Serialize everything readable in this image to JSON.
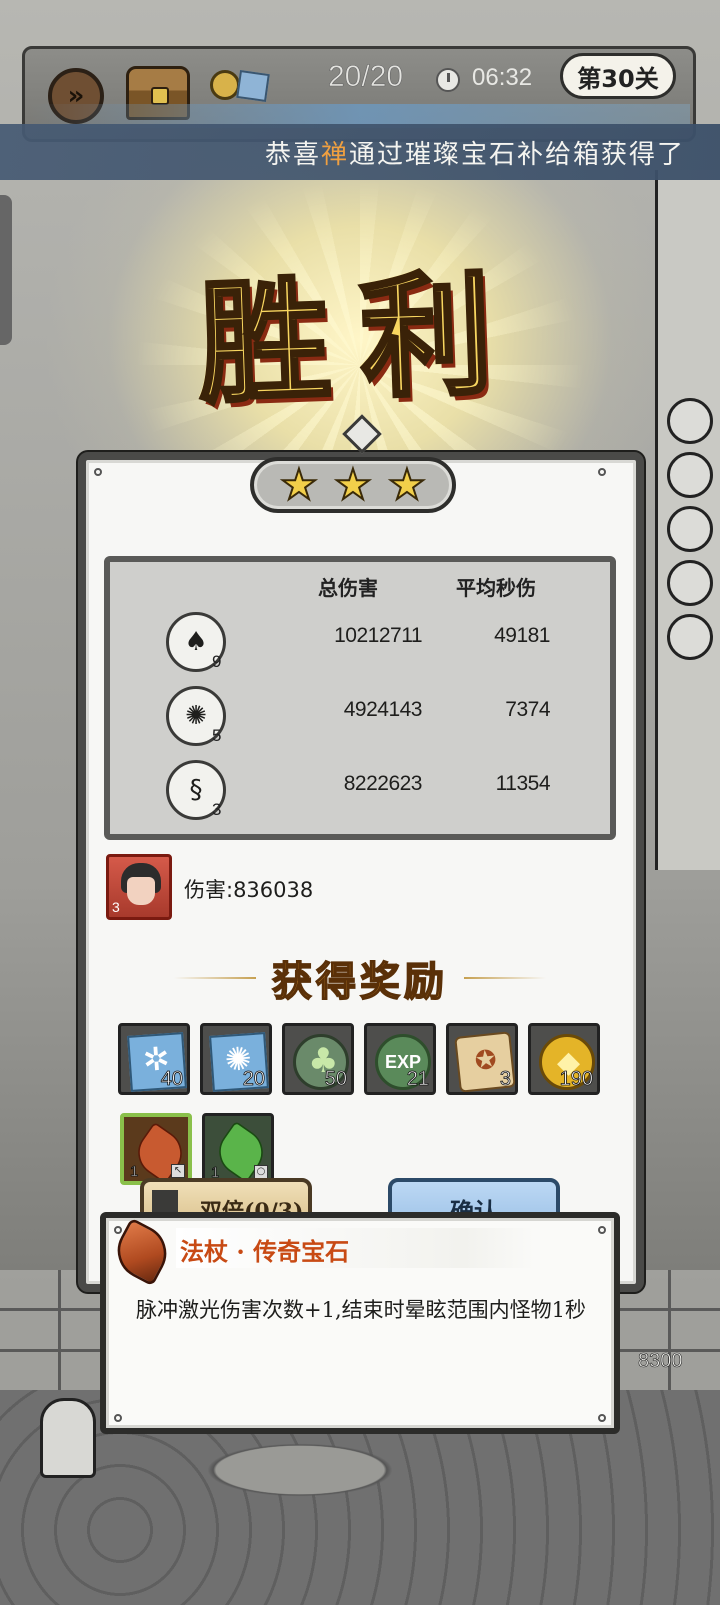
{
  "topbar": {
    "wave": "20/20",
    "timer": "06:32",
    "level": "第30关"
  },
  "announcement": {
    "prefix": "恭喜",
    "player": "禅",
    "suffix": "通过璀璨宝石补给箱获得了"
  },
  "victory": {
    "title": "胜利",
    "stars": 3
  },
  "stats": {
    "headers": [
      "总伤害",
      "平均秒伤"
    ],
    "rows": [
      {
        "icon": "dark-blades-skill-icon",
        "level": "9",
        "total": "10212711",
        "dps": "49181"
      },
      {
        "icon": "black-vortex-skill-icon",
        "level": "5",
        "total": "4924143",
        "dps": "7374"
      },
      {
        "icon": "whirlwind-skill-icon",
        "level": "3",
        "total": "8222623",
        "dps": "11354"
      }
    ]
  },
  "hero": {
    "level": "3",
    "damage_text": "伤害:836038"
  },
  "rewards": {
    "title": "获得奖励",
    "items": [
      {
        "icon": "blue-crystal-shard-icon",
        "qty": "40"
      },
      {
        "icon": "blue-spirit-gem-icon",
        "qty": "20"
      },
      {
        "icon": "green-leaf-emblem-icon",
        "qty": "50"
      },
      {
        "icon": "exp-orb-icon",
        "qty": "21",
        "label": "EXP"
      },
      {
        "icon": "scroll-icon",
        "qty": "3"
      },
      {
        "icon": "gold-coin-icon",
        "qty": "190"
      }
    ],
    "gems": [
      {
        "icon": "amber-gem-icon",
        "qty": "1"
      },
      {
        "icon": "green-gem-icon",
        "qty": "1"
      }
    ]
  },
  "buttons": {
    "double": "双倍(0/3)",
    "confirm": "确认"
  },
  "tooltip": {
    "title": "法杖 · 传奇宝石",
    "description": "脉冲激光伤害次数+1,结束时晕眩范围内怪物1秒"
  },
  "scene": {
    "score": "8300"
  },
  "colors": {
    "victory_gold": "#f8d660",
    "reward_title": "#d08c2a",
    "tooltip_title": "#c84a14",
    "announce_highlight": "#f0a040"
  }
}
